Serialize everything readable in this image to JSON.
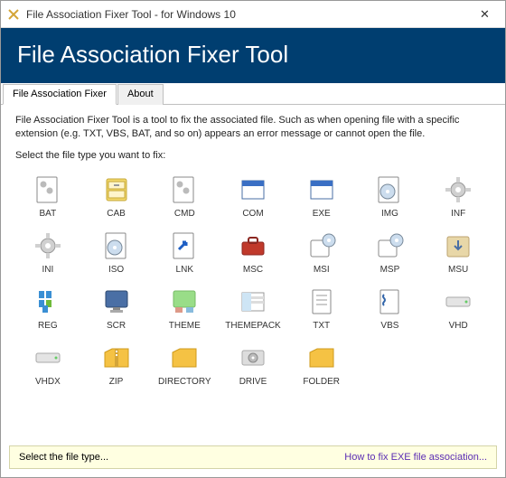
{
  "titlebar": {
    "title": "File Association Fixer Tool - for Windows 10",
    "app_icon": "tools-icon",
    "close_symbol": "✕"
  },
  "header": {
    "title": "File Association Fixer Tool"
  },
  "tabs": [
    {
      "label": "File Association Fixer",
      "active": true
    },
    {
      "label": "About",
      "active": false
    }
  ],
  "content": {
    "description": "File Association Fixer Tool is a tool to fix the associated file. Such as when opening file with a specific extension (e.g. TXT, VBS, BAT, and so on) appears an error message or cannot open the file.",
    "select_label": "Select the file type you want to fix:"
  },
  "file_types": [
    {
      "label": "BAT",
      "icon": "gear-page"
    },
    {
      "label": "CAB",
      "icon": "cabinet"
    },
    {
      "label": "CMD",
      "icon": "gear-page"
    },
    {
      "label": "COM",
      "icon": "window"
    },
    {
      "label": "EXE",
      "icon": "window"
    },
    {
      "label": "IMG",
      "icon": "disc-page"
    },
    {
      "label": "INF",
      "icon": "gear"
    },
    {
      "label": "INI",
      "icon": "gear"
    },
    {
      "label": "ISO",
      "icon": "disc-page"
    },
    {
      "label": "LNK",
      "icon": "shortcut"
    },
    {
      "label": "MSC",
      "icon": "toolbox"
    },
    {
      "label": "MSI",
      "icon": "installer"
    },
    {
      "label": "MSP",
      "icon": "installer"
    },
    {
      "label": "MSU",
      "icon": "update-box"
    },
    {
      "label": "REG",
      "icon": "registry"
    },
    {
      "label": "SCR",
      "icon": "monitor"
    },
    {
      "label": "THEME",
      "icon": "theme"
    },
    {
      "label": "THEMEPACK",
      "icon": "themepack"
    },
    {
      "label": "TXT",
      "icon": "text"
    },
    {
      "label": "VBS",
      "icon": "script"
    },
    {
      "label": "VHD",
      "icon": "drive"
    },
    {
      "label": "VHDX",
      "icon": "drive"
    },
    {
      "label": "ZIP",
      "icon": "zip"
    },
    {
      "label": "DIRECTORY",
      "icon": "folder"
    },
    {
      "label": "DRIVE",
      "icon": "harddrive"
    },
    {
      "label": "FOLDER",
      "icon": "folder"
    }
  ],
  "statusbar": {
    "status": "Select the file type...",
    "link": "How to fix EXE file association..."
  }
}
